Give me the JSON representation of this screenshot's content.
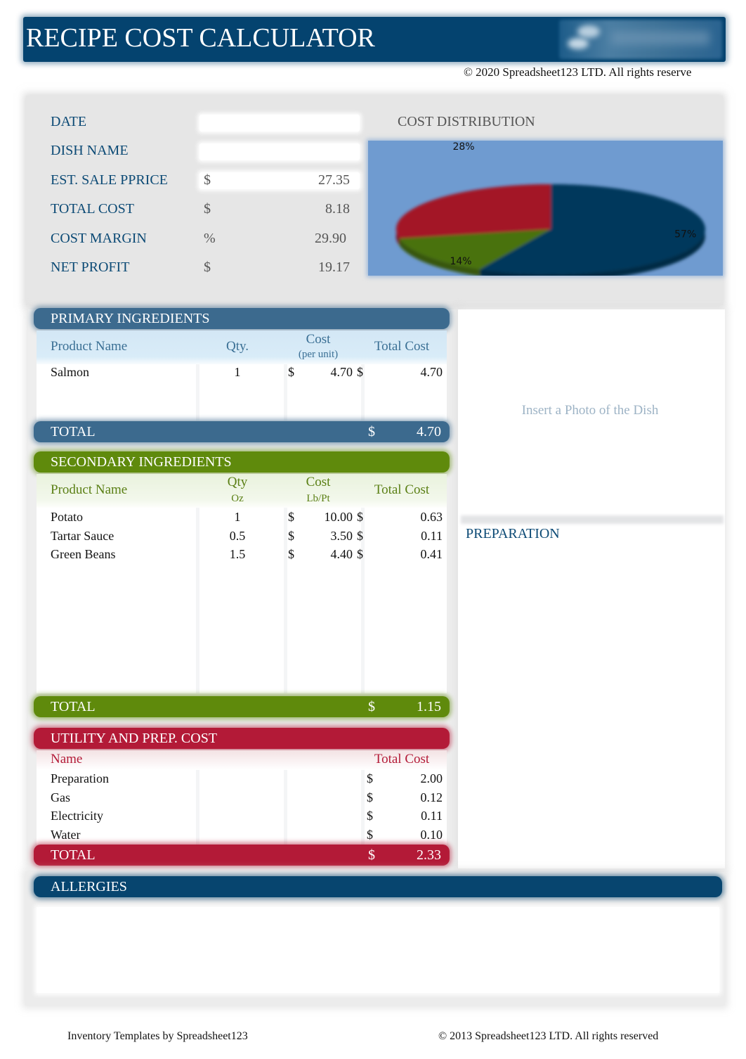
{
  "header": {
    "title": "RECIPE COST CALCULATOR",
    "copyright": "© 2020 Spreadsheet123 LTD. All rights reserve"
  },
  "summary": {
    "date": {
      "label": "DATE",
      "value": ""
    },
    "dish_name": {
      "label": "DISH NAME",
      "value": ""
    },
    "est_sale_price": {
      "label": "EST. SALE PPRICE",
      "symbol": "$",
      "value": "27.35"
    },
    "total_cost": {
      "label": "TOTAL COST",
      "symbol": "$",
      "value": "8.18"
    },
    "cost_margin": {
      "label": "COST MARGIN",
      "symbol": "%",
      "value": "29.90"
    },
    "net_profit": {
      "label": "NET PROFIT",
      "symbol": "$",
      "value": "19.17"
    }
  },
  "chart_data": {
    "type": "pie",
    "title": "COST DISTRIBUTION",
    "categories": [
      "Primary Ingredients",
      "Secondary Ingredients",
      "Utility and Prep. Cost"
    ],
    "values": [
      57,
      14,
      28
    ],
    "labels": [
      "57%",
      "14%",
      "28%"
    ],
    "colors": [
      "#02395c",
      "#4a7210",
      "#a31328"
    ],
    "background": "#6f9bd0",
    "style": "3d-tilted"
  },
  "primary": {
    "title": "PRIMARY INGREDIENTS",
    "columns": {
      "name": "Product Name",
      "qty": "Qty.",
      "cost": "Cost",
      "cost_sub": "(per unit)",
      "total": "Total Cost"
    },
    "rows": [
      {
        "name": "Salmon",
        "qty": "1",
        "cost_symbol": "$",
        "cost": "4.70",
        "total_symbol": "$",
        "total": "4.70"
      }
    ],
    "total_label": "TOTAL",
    "total_symbol": "$",
    "total_value": "4.70"
  },
  "secondary": {
    "title": "SECONDARY INGREDIENTS",
    "columns": {
      "name": "Product Name",
      "qty": "Qty",
      "qty_sub": "Oz",
      "cost": "Cost",
      "cost_sub": "Lb/Pt",
      "total": "Total Cost"
    },
    "rows": [
      {
        "name": "Potato",
        "qty": "1",
        "cost_symbol": "$",
        "cost": "10.00",
        "total_symbol": "$",
        "total": "0.63"
      },
      {
        "name": "Tartar Sauce",
        "qty": "0.5",
        "cost_symbol": "$",
        "cost": "3.50",
        "total_symbol": "$",
        "total": "0.11"
      },
      {
        "name": "Green Beans",
        "qty": "1.5",
        "cost_symbol": "$",
        "cost": "4.40",
        "total_symbol": "$",
        "total": "0.41"
      }
    ],
    "total_label": "TOTAL",
    "total_symbol": "$",
    "total_value": "1.15"
  },
  "utility": {
    "title": "UTILITY AND PREP. COST",
    "columns": {
      "name": "Name",
      "total": "Total Cost"
    },
    "rows": [
      {
        "name": "Preparation",
        "symbol": "$",
        "total": "2.00"
      },
      {
        "name": "Gas",
        "symbol": "$",
        "total": "0.12"
      },
      {
        "name": "Electricity",
        "symbol": "$",
        "total": "0.11"
      },
      {
        "name": "Water",
        "symbol": "$",
        "total": "0.10"
      }
    ],
    "total_label": "TOTAL",
    "total_symbol": "$",
    "total_value": "2.33"
  },
  "photo": {
    "placeholder": "Insert a Photo of the Dish"
  },
  "preparation": {
    "title": "PREPARATION",
    "value": ""
  },
  "allergies": {
    "title": "ALLERGIES",
    "value": ""
  },
  "footer": {
    "left": "Inventory Templates by Spreadsheet123",
    "right": "© 2013 Spreadsheet123 LTD. All rights reserved"
  }
}
